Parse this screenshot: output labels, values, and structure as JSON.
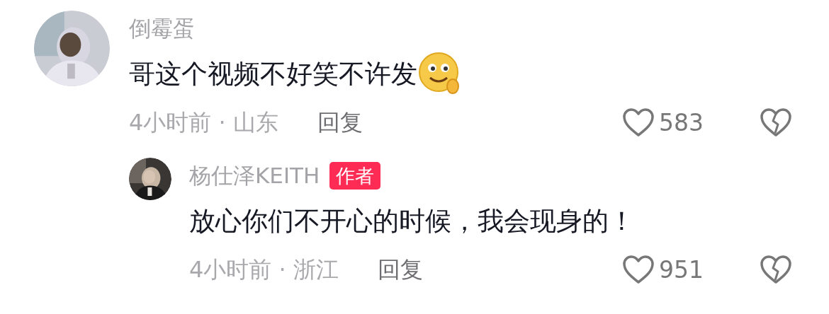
{
  "comments": [
    {
      "author": "倒霉蛋",
      "text": "哥这个视频不好笑不许发",
      "emoji": true,
      "time_location": "4小时前 · 山东",
      "reply_label": "回复",
      "likes": "583",
      "replies": [
        {
          "author": "杨仕泽KEITH",
          "badge": "作者",
          "text": "放心你们不开心的时候，我会现身的！",
          "emoji": false,
          "time_location": "4小时前 · 浙江",
          "reply_label": "回复",
          "likes": "951"
        }
      ]
    }
  ]
}
